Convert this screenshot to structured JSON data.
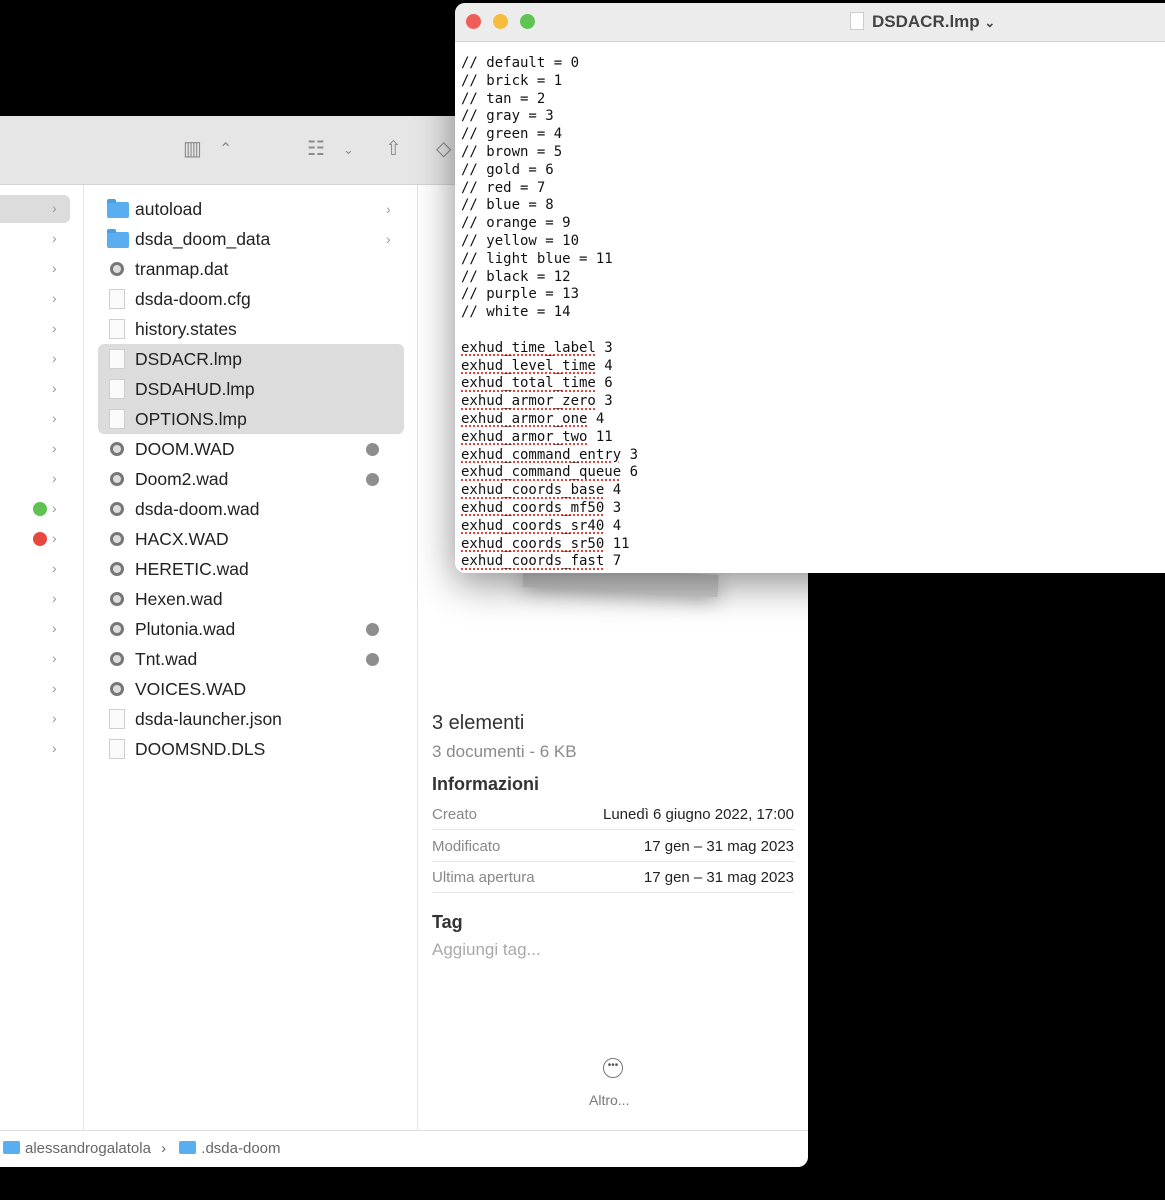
{
  "editor": {
    "title": "DSDACR.lmp",
    "lines": [
      "// default = 0",
      "// brick = 1",
      "// tan = 2",
      "// gray = 3",
      "// green = 4",
      "// brown = 5",
      "// gold = 6",
      "// red = 7",
      "// blue = 8",
      "// orange = 9",
      "// yellow = 10",
      "// light blue = 11",
      "// black = 12",
      "// purple = 13",
      "// white = 14"
    ],
    "settings": [
      {
        "k": "exhud_time_label",
        "v": "3"
      },
      {
        "k": "exhud_level_time",
        "v": "4"
      },
      {
        "k": "exhud_total_time",
        "v": "6"
      },
      {
        "k": "exhud_armor_zero",
        "v": "3"
      },
      {
        "k": "exhud_armor_one",
        "v": "4"
      },
      {
        "k": "exhud_armor_two",
        "v": "11"
      },
      {
        "k": "exhud_command_entry",
        "v": "3"
      },
      {
        "k": "exhud_command_queue",
        "v": "6"
      },
      {
        "k": "exhud_coords_base",
        "v": "4"
      },
      {
        "k": "exhud_coords_mf50",
        "v": "3"
      },
      {
        "k": "exhud_coords_sr40",
        "v": "4"
      },
      {
        "k": "exhud_coords_sr50",
        "v": "11"
      },
      {
        "k": "exhud_coords_fast",
        "v": "7"
      }
    ]
  },
  "files": [
    {
      "name": "autoload",
      "type": "folder",
      "chev": true
    },
    {
      "name": "dsda_doom_data",
      "type": "folder",
      "chev": true
    },
    {
      "name": "tranmap.dat",
      "type": "exec"
    },
    {
      "name": "dsda-doom.cfg",
      "type": "doc"
    },
    {
      "name": "history.states",
      "type": "doc"
    },
    {
      "name": "DSDACR.lmp",
      "type": "doc",
      "selected": true
    },
    {
      "name": "DSDAHUD.lmp",
      "type": "doc",
      "selected": true
    },
    {
      "name": "OPTIONS.lmp",
      "type": "doc",
      "selected": true
    },
    {
      "name": "DOOM.WAD",
      "type": "exec",
      "dot": true
    },
    {
      "name": "Doom2.wad",
      "type": "exec",
      "dot": true
    },
    {
      "name": "dsda-doom.wad",
      "type": "exec"
    },
    {
      "name": "HACX.WAD",
      "type": "exec"
    },
    {
      "name": "HERETIC.wad",
      "type": "exec"
    },
    {
      "name": "Hexen.wad",
      "type": "exec"
    },
    {
      "name": "Plutonia.wad",
      "type": "exec",
      "dot": true
    },
    {
      "name": "Tnt.wad",
      "type": "exec",
      "dot": true
    },
    {
      "name": "VOICES.WAD",
      "type": "exec"
    },
    {
      "name": "dsda-launcher.json",
      "type": "doc"
    },
    {
      "name": "DOOMSND.DLS",
      "type": "audio"
    }
  ],
  "left_tags": {
    "10": "#5fc152",
    "11": "#e6483f"
  },
  "preview": {
    "title": "3 elementi",
    "subtitle": "3 documenti - 6 KB",
    "info_heading": "Informazioni",
    "info": [
      {
        "k": "Creato",
        "v": "Lunedì 6 giugno 2022, 17:00"
      },
      {
        "k": "Modificato",
        "v": "17 gen – 31 mag 2023"
      },
      {
        "k": "Ultima apertura",
        "v": "17 gen – 31 mag 2023"
      }
    ],
    "tag_heading": "Tag",
    "tag_placeholder": "Aggiungi tag...",
    "more_label": "Altro..."
  },
  "path": [
    "alessandrogalatola",
    ".dsda-doom"
  ]
}
